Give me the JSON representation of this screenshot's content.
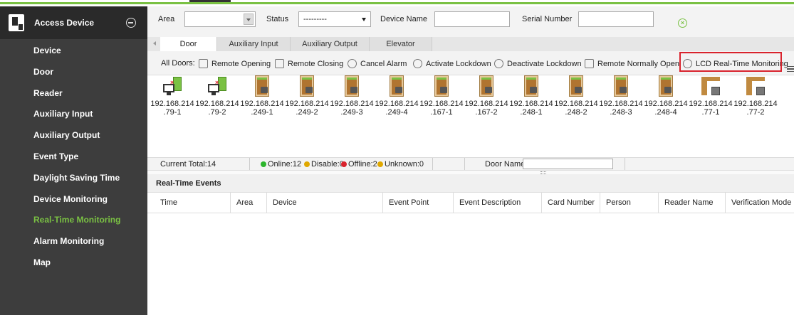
{
  "sidebar": {
    "title": "Access Device",
    "items": [
      {
        "label": "Device",
        "active": false
      },
      {
        "label": "Door",
        "active": false
      },
      {
        "label": "Reader",
        "active": false
      },
      {
        "label": "Auxiliary Input",
        "active": false
      },
      {
        "label": "Auxiliary Output",
        "active": false
      },
      {
        "label": "Event Type",
        "active": false
      },
      {
        "label": "Daylight Saving Time",
        "active": false
      },
      {
        "label": "Device Monitoring",
        "active": false
      },
      {
        "label": "Real-Time Monitoring",
        "active": true
      },
      {
        "label": "Alarm Monitoring",
        "active": false
      },
      {
        "label": "Map",
        "active": false
      }
    ]
  },
  "filters": {
    "area_label": "Area",
    "area_value": "",
    "status_label": "Status",
    "status_value": "---------",
    "device_name_label": "Device Name",
    "device_name_value": "",
    "serial_number_label": "Serial Number",
    "serial_number_value": ""
  },
  "tabs": [
    {
      "label": "Door",
      "active": true
    },
    {
      "label": "Auxiliary Input",
      "active": false
    },
    {
      "label": "Auxiliary Output",
      "active": false
    },
    {
      "label": "Elevator",
      "active": false
    }
  ],
  "toolbar": {
    "all_doors_label": "All Doors:",
    "actions": [
      {
        "label": "Remote Opening",
        "icon": "door-open-icon"
      },
      {
        "label": "Remote Closing",
        "icon": "door-close-icon"
      },
      {
        "label": "Cancel Alarm",
        "icon": "cancel-alarm-icon"
      },
      {
        "label": "Activate Lockdown",
        "icon": "lockdown-icon"
      },
      {
        "label": "Deactivate Lockdown",
        "icon": "unlock-lockdown-icon"
      },
      {
        "label": "Remote Normally Open",
        "icon": "lock-open-icon"
      },
      {
        "label": "LCD Real-Time Monitoring",
        "icon": "user-monitor-icon"
      }
    ]
  },
  "doors": [
    {
      "line1": "192.168.214",
      "line2": ".79-1",
      "kind": "monitor"
    },
    {
      "line1": "192.168.214",
      "line2": ".79-2",
      "kind": "monitor"
    },
    {
      "line1": "192.168.214",
      "line2": ".249-1",
      "kind": "locked"
    },
    {
      "line1": "192.168.214",
      "line2": ".249-2",
      "kind": "locked"
    },
    {
      "line1": "192.168.214",
      "line2": ".249-3",
      "kind": "locked"
    },
    {
      "line1": "192.168.214",
      "line2": ".249-4",
      "kind": "locked"
    },
    {
      "line1": "192.168.214",
      "line2": ".167-1",
      "kind": "locked"
    },
    {
      "line1": "192.168.214",
      "line2": ".167-2",
      "kind": "locked"
    },
    {
      "line1": "192.168.214",
      "line2": ".248-1",
      "kind": "locked"
    },
    {
      "line1": "192.168.214",
      "line2": ".248-2",
      "kind": "locked"
    },
    {
      "line1": "192.168.214",
      "line2": ".248-3",
      "kind": "locked"
    },
    {
      "line1": "192.168.214",
      "line2": ".248-4",
      "kind": "locked"
    },
    {
      "line1": "192.168.214",
      "line2": ".77-1",
      "kind": "elevator"
    },
    {
      "line1": "192.168.214",
      "line2": ".77-2",
      "kind": "elevator"
    }
  ],
  "status": {
    "current_total": "Current Total:14",
    "online": "Online:12",
    "disable": "Disable:0",
    "offline": "Offline:2",
    "unknown": "Unknown:0",
    "door_name_label": "Door Name",
    "door_name_value": "",
    "colors": {
      "online": "#2db52d",
      "disable": "#e0a800",
      "offline": "#d9232d",
      "unknown": "#e0a800"
    }
  },
  "events": {
    "title": "Real-Time Events",
    "columns": [
      "Time",
      "Area",
      "Device",
      "Event Point",
      "Event Description",
      "Card Number",
      "Person",
      "Reader Name",
      "Verification Mode"
    ]
  },
  "colors": {
    "accent": "#7ac143",
    "highlight": "#d9232d",
    "sidebar_bg": "#3d3d3d"
  }
}
